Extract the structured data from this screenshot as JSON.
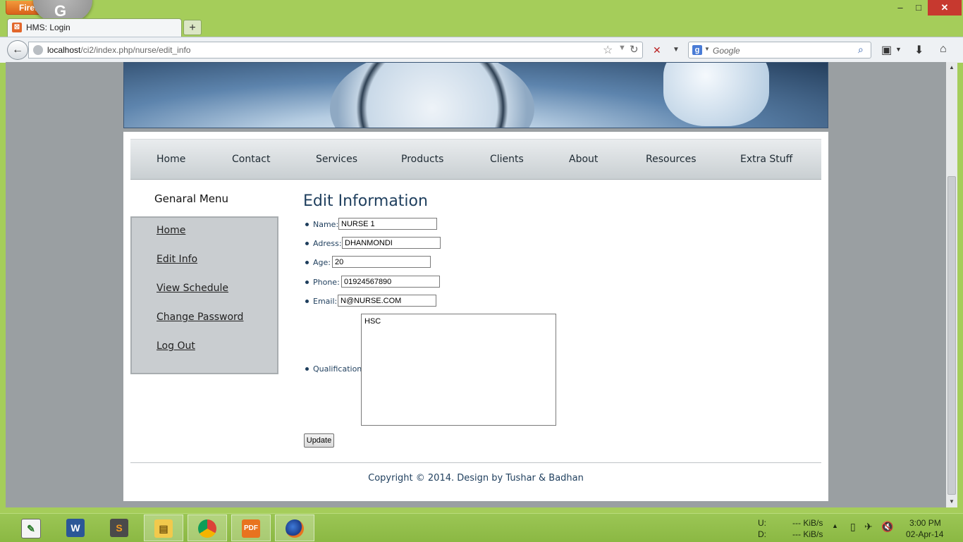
{
  "browser": {
    "app_button": "Firefox",
    "overlay_letter": "G",
    "tab_title": "HMS: Login",
    "new_tab": "+",
    "url_host": "localhost",
    "url_path": "/ci2/index.php/nurse/edit_info",
    "search_placeholder": "Google",
    "window": {
      "minimize": "–",
      "maximize": "□",
      "close": "✕"
    }
  },
  "topnav": [
    "Home",
    "Contact",
    "Services",
    "Products",
    "Clients",
    "About",
    "Resources",
    "Extra Stuff"
  ],
  "sidebar": {
    "title": "Genaral Menu",
    "items": [
      "Home",
      "Edit Info",
      "View Schedule",
      "Change Password",
      "Log Out"
    ]
  },
  "form": {
    "title": "Edit Information",
    "fields": [
      {
        "label": "Name:",
        "value": "NURSE 1"
      },
      {
        "label": "Adress:",
        "value": "DHANMONDI"
      },
      {
        "label": "Age:",
        "value": "20"
      },
      {
        "label": "Phone:",
        "value": "01924567890"
      },
      {
        "label": "Email:",
        "value": "N@NURSE.COM"
      }
    ],
    "qualification": {
      "label": "Qualification:",
      "value": "HSC"
    },
    "update_label": "Update"
  },
  "footer": {
    "copyright": "Copyright © 2014. Design by Tushar & Badhan"
  },
  "taskbar": {
    "apps": [
      "desktop-gadget",
      "word",
      "sublime-text",
      "file-explorer",
      "chrome",
      "pdf-reader",
      "firefox"
    ],
    "net_up_label": "U:",
    "net_down_label": "D:",
    "net_up": "--- KiB/s",
    "net_down": "--- KiB/s",
    "time": "3:00 PM",
    "date": "02-Apr-14"
  }
}
